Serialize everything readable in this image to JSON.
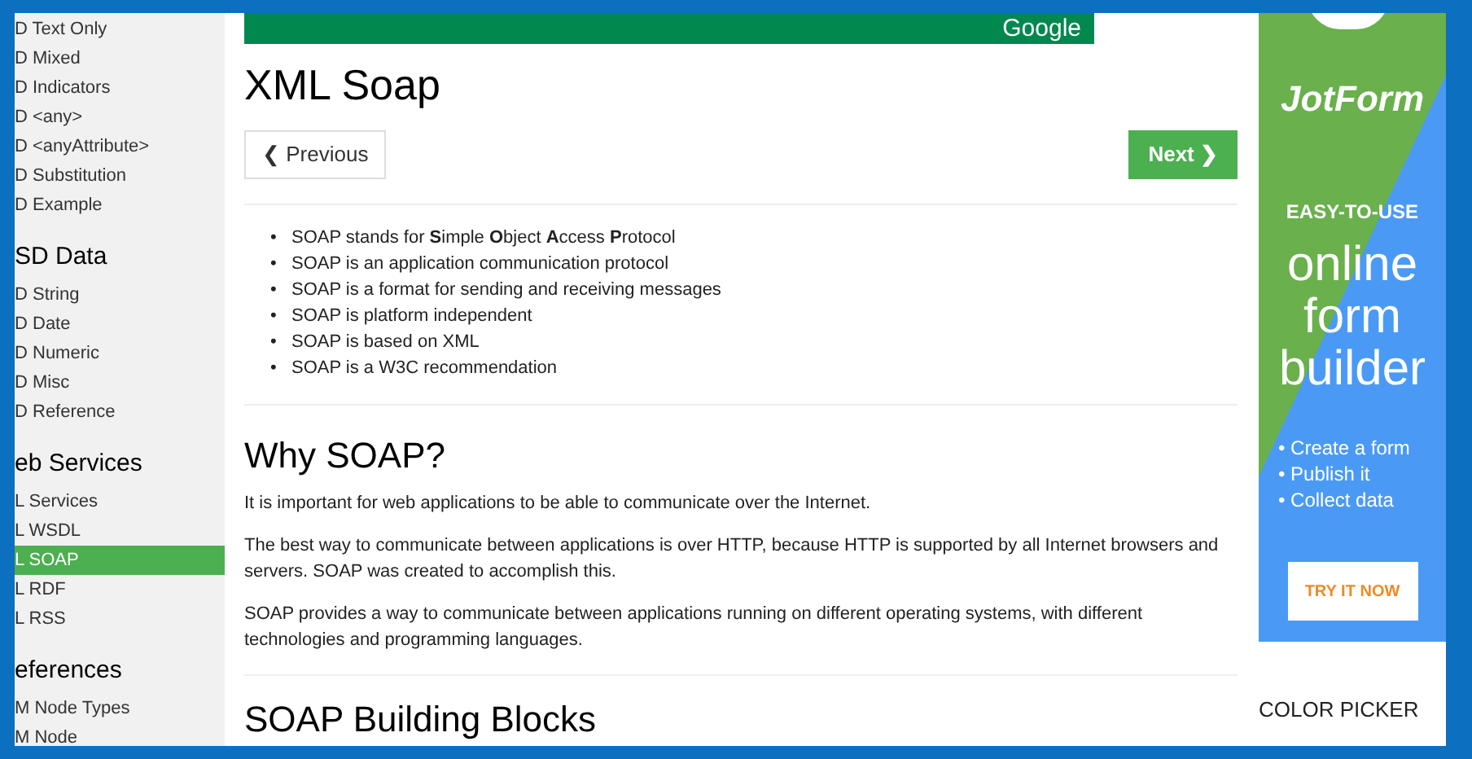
{
  "sidebar": {
    "items": [
      {
        "kind": "link",
        "label": "D Text Only",
        "selected": false
      },
      {
        "kind": "link",
        "label": "D Mixed",
        "selected": false
      },
      {
        "kind": "link",
        "label": "D Indicators",
        "selected": false
      },
      {
        "kind": "link",
        "label": "D <any>",
        "selected": false
      },
      {
        "kind": "link",
        "label": "D <anyAttribute>",
        "selected": false
      },
      {
        "kind": "link",
        "label": "D Substitution",
        "selected": false
      },
      {
        "kind": "link",
        "label": "D Example",
        "selected": false
      },
      {
        "kind": "heading",
        "label": "SD Data"
      },
      {
        "kind": "link",
        "label": "D String",
        "selected": false
      },
      {
        "kind": "link",
        "label": "D Date",
        "selected": false
      },
      {
        "kind": "link",
        "label": "D Numeric",
        "selected": false
      },
      {
        "kind": "link",
        "label": "D Misc",
        "selected": false
      },
      {
        "kind": "link",
        "label": "D Reference",
        "selected": false
      },
      {
        "kind": "heading",
        "label": "eb Services"
      },
      {
        "kind": "link",
        "label": "L Services",
        "selected": false
      },
      {
        "kind": "link",
        "label": "L WSDL",
        "selected": false
      },
      {
        "kind": "link",
        "label": "L SOAP",
        "selected": true
      },
      {
        "kind": "link",
        "label": "L RDF",
        "selected": false
      },
      {
        "kind": "link",
        "label": "L RSS",
        "selected": false
      },
      {
        "kind": "heading",
        "label": "eferences"
      },
      {
        "kind": "link",
        "label": "M Node Types",
        "selected": false
      },
      {
        "kind": "link",
        "label": "M Node",
        "selected": false
      }
    ]
  },
  "banner": {
    "brand": "Google"
  },
  "main": {
    "title": "XML Soap",
    "prev_button": "❮ Previous",
    "next_button": "Next ❯",
    "bullets": [
      {
        "marker": "•",
        "text": "SOAP stands for **S**imple **O**bject **A**ccess **P**rotocol"
      },
      {
        "marker": "•",
        "text": "SOAP is an application communication protocol"
      },
      {
        "marker": "•",
        "text": "SOAP is a format for sending and receiving messages"
      },
      {
        "marker": "•",
        "text": "SOAP is platform independent"
      },
      {
        "marker": "•",
        "text": "SOAP is based on XML"
      },
      {
        "marker": "•",
        "text": "SOAP is a W3C recommendation"
      }
    ],
    "section": {
      "heading": "Why SOAP?",
      "paragraphs": [
        "It is important for web applications to be able to communicate over the Internet.",
        "The best way to communicate between applications is over HTTP, because HTTP is supported by all Internet browsers and servers. SOAP was created to accomplish this.",
        "SOAP provides a way to communicate between applications running on different operating systems, with different technologies and programming languages."
      ]
    },
    "next_heading": "SOAP Building Blocks"
  },
  "ad": {
    "brand": "JotForm",
    "tagline": "EASY-TO-USE",
    "headline": [
      "online",
      "form",
      "builder"
    ],
    "features": [
      "• Create a form",
      "• Publish it",
      "• Collect data"
    ],
    "cta": "TRY IT NOW"
  },
  "color_picker": {
    "title": "COLOR PICKER"
  }
}
